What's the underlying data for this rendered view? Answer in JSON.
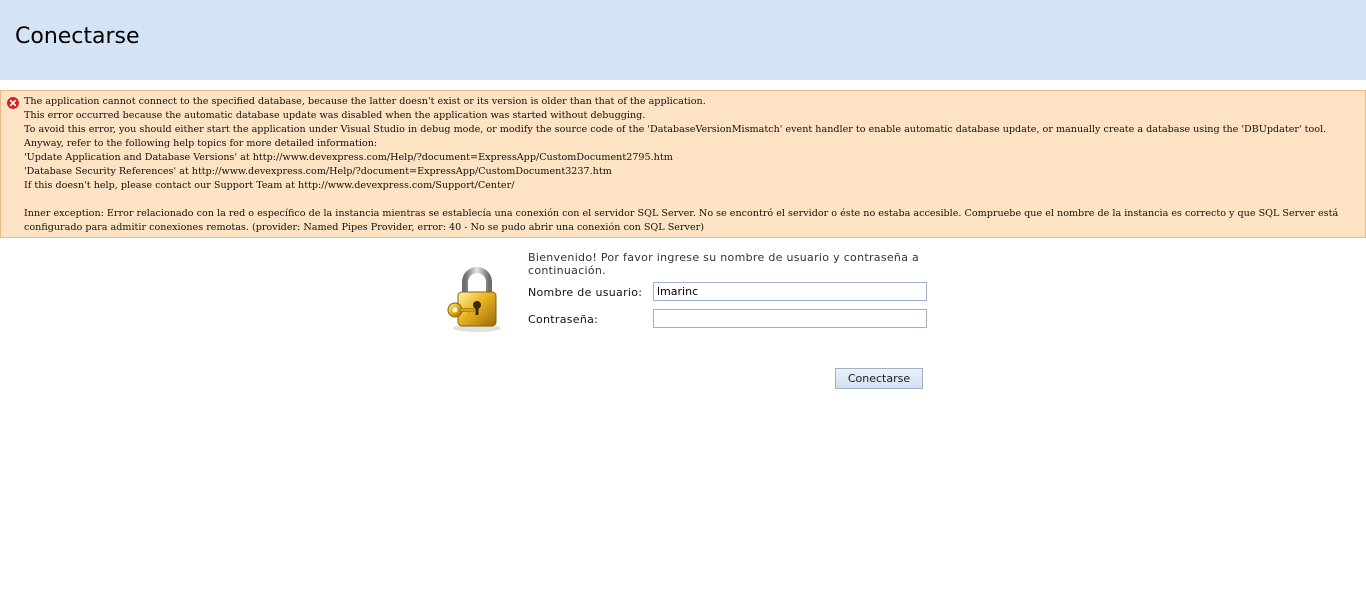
{
  "header": {
    "title": "Conectarse"
  },
  "error": {
    "icon": "error-x-icon",
    "lines": [
      "The application cannot connect to the specified database, because the latter doesn't exist or its version is older than that of the application.",
      "This error occurred because the automatic database update was disabled when the application was started without debugging.",
      "To avoid this error, you should either start the application under Visual Studio in debug mode, or modify the source code of the 'DatabaseVersionMismatch' event handler to enable automatic database update, or manually create a database using the 'DBUpdater' tool.",
      "Anyway, refer to the following help topics for more detailed information:",
      "'Update Application and Database Versions' at http://www.devexpress.com/Help/?document=ExpressApp/CustomDocument2795.htm",
      "'Database Security References' at http://www.devexpress.com/Help/?document=ExpressApp/CustomDocument3237.htm",
      "If this doesn't help, please contact our Support Team at http://www.devexpress.com/Support/Center/"
    ],
    "inner_exception": "Inner exception: Error relacionado con la red o específico de la instancia mientras se establecía una conexión con el servidor SQL Server. No se encontró el servidor o éste no estaba accesible. Compruebe que el nombre de la instancia es correcto y que SQL Server está configurado para admitir conexiones remotas. (provider: Named Pipes Provider, error: 40 - No se pudo abrir una conexión con SQL Server)"
  },
  "login": {
    "icon": "lock-key-icon",
    "welcome": "Bienvenido! Por favor ingrese su nombre de usuario y contraseña a continuación.",
    "username_label": "Nombre de usuario:",
    "username_value": "lmarinc",
    "password_label": "Contraseña:",
    "password_value": "",
    "submit_label": "Conectarse"
  },
  "colors": {
    "header_bg": "#d5e4f5",
    "error_bg": "#fde2c3",
    "error_icon": "#d9251d"
  }
}
